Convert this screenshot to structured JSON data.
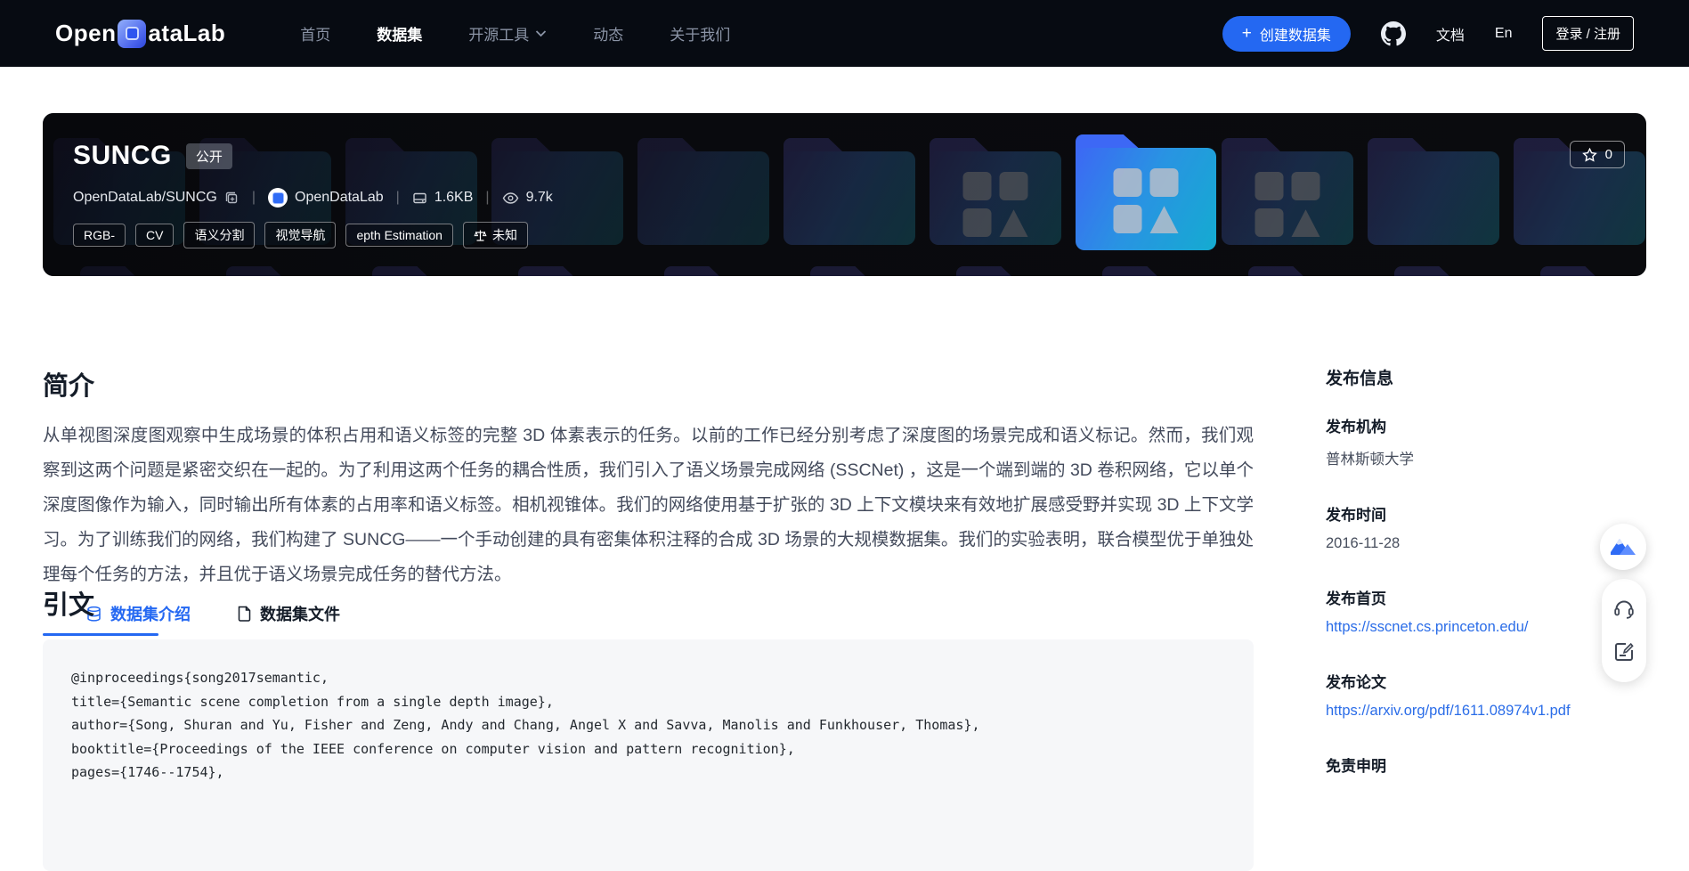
{
  "navbar": {
    "logo_open": "Open",
    "logo_rest": "ataLab",
    "links": [
      {
        "label": "首页"
      },
      {
        "label": "数据集"
      },
      {
        "label": "开源工具"
      },
      {
        "label": "动态"
      },
      {
        "label": "关于我们"
      }
    ],
    "create_button_label": "创建数据集",
    "plus": "+",
    "docs_label": "文档",
    "lang_label": "En",
    "login_label": "登录 / 注册"
  },
  "hero": {
    "title": "SUNCG",
    "visibility_badge": "公开",
    "repo_path": "OpenDataLab/SUNCG",
    "org_name": "OpenDataLab",
    "size": "1.6KB",
    "views": "9.7k",
    "star_count": "0",
    "tags": [
      "RGB-",
      "CV",
      "语义分割",
      "视觉导航",
      "epth Estimation"
    ],
    "license_tag": "未知"
  },
  "tabs": {
    "intro": "数据集介绍",
    "files": "数据集文件"
  },
  "content": {
    "intro_heading": "简介",
    "intro_text": "从单视图深度图观察中生成场景的体积占用和语义标签的完整 3D 体素表示的任务。以前的工作已经分别考虑了深度图的场景完成和语义标记。然而，我们观察到这两个问题是紧密交织在一起的。为了利用这两个任务的耦合性质，我们引入了语义场景完成网络 (SSCNet) ，这是一个端到端的 3D 卷积网络，它以单个深度图像作为输入，同时输出所有体素的占用率和语义标签。相机视锥体。我们的网络使用基于扩张的 3D 上下文模块来有效地扩展感受野并实现 3D 上下文学习。为了训练我们的网络，我们构建了 SUNCG——一个手动创建的具有密集体积注释的合成 3D 场景的大规模数据集。我们的实验表明，联合模型优于单独处理每个任务的方法，并且优于语义场景完成任务的替代方法。",
    "citation_heading": "引文",
    "citation_lines": [
      "@inproceedings{song2017semantic,",
      "title={Semantic scene completion from a single depth image},",
      "author={Song, Shuran and Yu, Fisher and Zeng, Andy and Chang, Angel X and Savva, Manolis and Funkhouser, Thomas},",
      "booktitle={Proceedings of the IEEE conference on computer vision and pattern recognition},",
      "pages={1746--1754},"
    ]
  },
  "sidebar": {
    "heading": "发布信息",
    "org_label": "发布机构",
    "org_value": "普林斯顿大学",
    "date_label": "发布时间",
    "date_value": "2016-11-28",
    "homepage_label": "发布首页",
    "homepage_value": "https://sscnet.cs.princeton.edu/",
    "paper_label": "发布论文",
    "paper_value": "https://arxiv.org/pdf/1611.08974v1.pdf",
    "disclaimer_label": "免责申明"
  },
  "colors": {
    "accent_blue": "#2468f2",
    "link_blue": "#2b6de8",
    "navbar_bg": "#070b12",
    "banner_bg": "#0c0d10"
  }
}
